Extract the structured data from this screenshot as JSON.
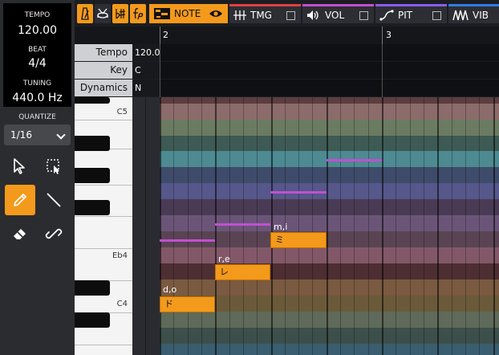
{
  "left_panel": {
    "tempo_label": "TEMPO",
    "tempo_value": "120.00",
    "beat_label": "BEAT",
    "beat_value": "4/4",
    "tuning_label": "TUNING",
    "tuning_value": "440.0 Hz",
    "quantize_label": "QUANTIZE",
    "quantize_value": "1/16",
    "tools": [
      "select-arrow-icon",
      "rect-select-icon",
      "pencil-icon",
      "line-icon",
      "eraser-icon",
      "link-break-icon"
    ],
    "active_tool": "pencil-icon"
  },
  "toolbar": {
    "tabs": [
      {
        "label": "NOTE",
        "active": true,
        "accent": "#f39a1c"
      },
      {
        "label": "TMG",
        "active": false,
        "accent": "#e04040"
      },
      {
        "label": "VOL",
        "active": false,
        "accent": "#c04fd0"
      },
      {
        "label": "PIT",
        "active": false,
        "accent": "#8a5cf0"
      },
      {
        "label": "VIB",
        "active": false,
        "accent": "#2f7de0"
      }
    ]
  },
  "ruler": {
    "measures": [
      "2",
      "3"
    ]
  },
  "properties": [
    {
      "label": "Tempo",
      "value": "120.0"
    },
    {
      "label": "Key",
      "value": "C"
    },
    {
      "label": "Dynamics",
      "value": "N"
    }
  ],
  "piano": {
    "labels": [
      "C5",
      "Eb4",
      "C4"
    ]
  },
  "notes": [
    {
      "lyric": "d,o",
      "text": "ド",
      "pitch": "C4"
    },
    {
      "lyric": "r,e",
      "text": "レ",
      "pitch": "D4"
    },
    {
      "lyric": "m,i",
      "text": "ミ",
      "pitch": "E4"
    }
  ],
  "colors": {
    "accent": "#f39a1c",
    "pitch_line": "#c24fd2"
  }
}
